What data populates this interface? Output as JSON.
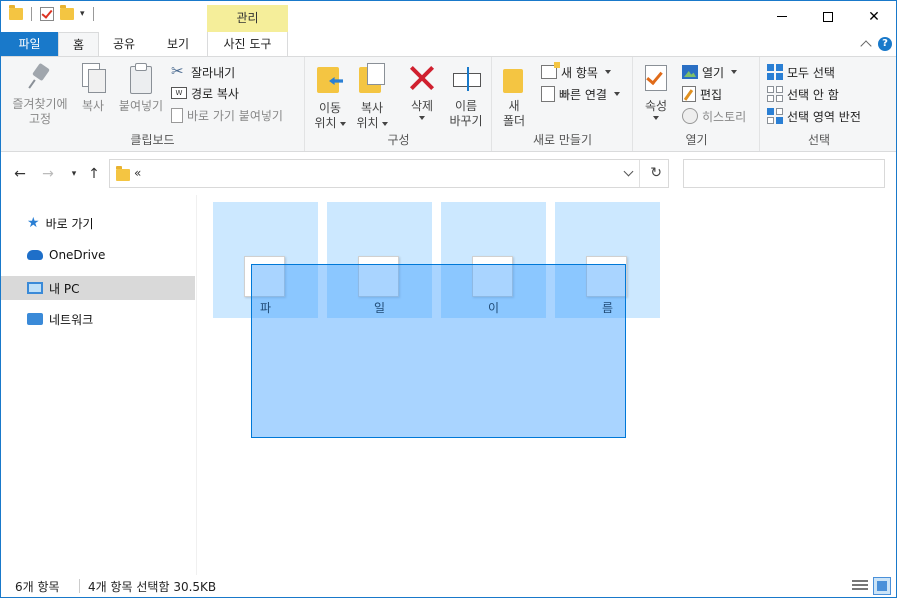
{
  "titlebar": {
    "contextual_tab": "관리",
    "qat_more": "▾"
  },
  "tabs": {
    "file": "파일",
    "home": "홈",
    "share": "공유",
    "view": "보기",
    "photo_tools": "사진 도구"
  },
  "ribbon": {
    "clipboard": {
      "label": "클립보드",
      "pin_line1": "즐겨찾기에",
      "pin_line2": "고정",
      "copy": "복사",
      "paste": "붙여넣기",
      "cut": "잘라내기",
      "copy_path": "경로 복사",
      "paste_shortcut": "바로 가기 붙여넣기"
    },
    "organize": {
      "label": "구성",
      "move_line1": "이동",
      "move_line2": "위치",
      "copyto_line1": "복사",
      "copyto_line2": "위치",
      "delete": "삭제",
      "rename_line1": "이름",
      "rename_line2": "바꾸기"
    },
    "new": {
      "label": "새로 만들기",
      "new_folder_line1": "새",
      "new_folder_line2": "폴더",
      "new_item": "새 항목",
      "easy_access": "빠른 연결"
    },
    "open": {
      "label": "열기",
      "properties": "속성",
      "open": "열기",
      "edit": "편집",
      "history": "히스토리"
    },
    "select": {
      "label": "선택",
      "select_all": "모두 선택",
      "select_none": "선택 안 함",
      "invert": "선택 영역 반전"
    }
  },
  "address": {
    "path": "«",
    "search_placeholder": ""
  },
  "sidebar": {
    "items": [
      {
        "label": "바로 가기"
      },
      {
        "label": "OneDrive"
      },
      {
        "label": "내 PC"
      },
      {
        "label": "네트워크"
      }
    ]
  },
  "files": [
    {
      "name": "파"
    },
    {
      "name": "일"
    },
    {
      "name": "이"
    },
    {
      "name": "름"
    }
  ],
  "status": {
    "count": "6개 항목",
    "selection": "4개 항목 선택함 30.5KB"
  },
  "colors": {
    "accent": "#1979ca",
    "selection_fill": "#cce8ff",
    "marquee": "#3399ff"
  }
}
